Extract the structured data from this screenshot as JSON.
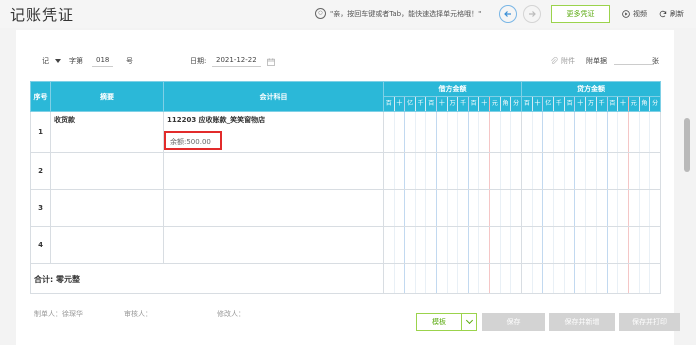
{
  "header": {
    "title": "记账凭证",
    "tip": "\"亲，按回车键或者Tab，能快速选择单元格哦！\"",
    "more_vouchers": "更多凭证",
    "video": "视频",
    "refresh": "刷新"
  },
  "voucher": {
    "word_prefix": "记",
    "word_label": "字第",
    "number": "018",
    "number_suffix": "号",
    "date_label": "日期:",
    "date": "2021-12-22",
    "attachment": "附件",
    "attach_count_label": "附单据",
    "attach_unit": "张"
  },
  "table": {
    "headers": {
      "seq": "序号",
      "summary": "摘要",
      "account": "会计科目",
      "debit": "借方金额",
      "credit": "贷方金额"
    },
    "digit_units": [
      "百",
      "十",
      "亿",
      "千",
      "百",
      "十",
      "万",
      "千",
      "百",
      "十",
      "元",
      "角",
      "分"
    ],
    "rows": [
      {
        "no": "1",
        "summary": "收货款",
        "account": "112203 应收账款_笑笑窗物店",
        "balance": "余额:500.00"
      },
      {
        "no": "2",
        "summary": "",
        "account": "",
        "balance": ""
      },
      {
        "no": "3",
        "summary": "",
        "account": "",
        "balance": ""
      },
      {
        "no": "4",
        "summary": "",
        "account": "",
        "balance": ""
      }
    ],
    "total_label": "合计:",
    "total_amount": "零元整"
  },
  "footer": {
    "maker": "制单人：徐琛华",
    "reviewer": "审核人：",
    "modifier": "修改人："
  },
  "buttons": {
    "template": "模板",
    "save": "保存",
    "save_new": "保存并新增",
    "save_print": "保存并打印"
  },
  "colors": {
    "header_bg": "#2bb8d8",
    "accent_green": "#5cab12",
    "highlight_red": "#e22b2b",
    "nav_blue": "#3a8fd6"
  }
}
